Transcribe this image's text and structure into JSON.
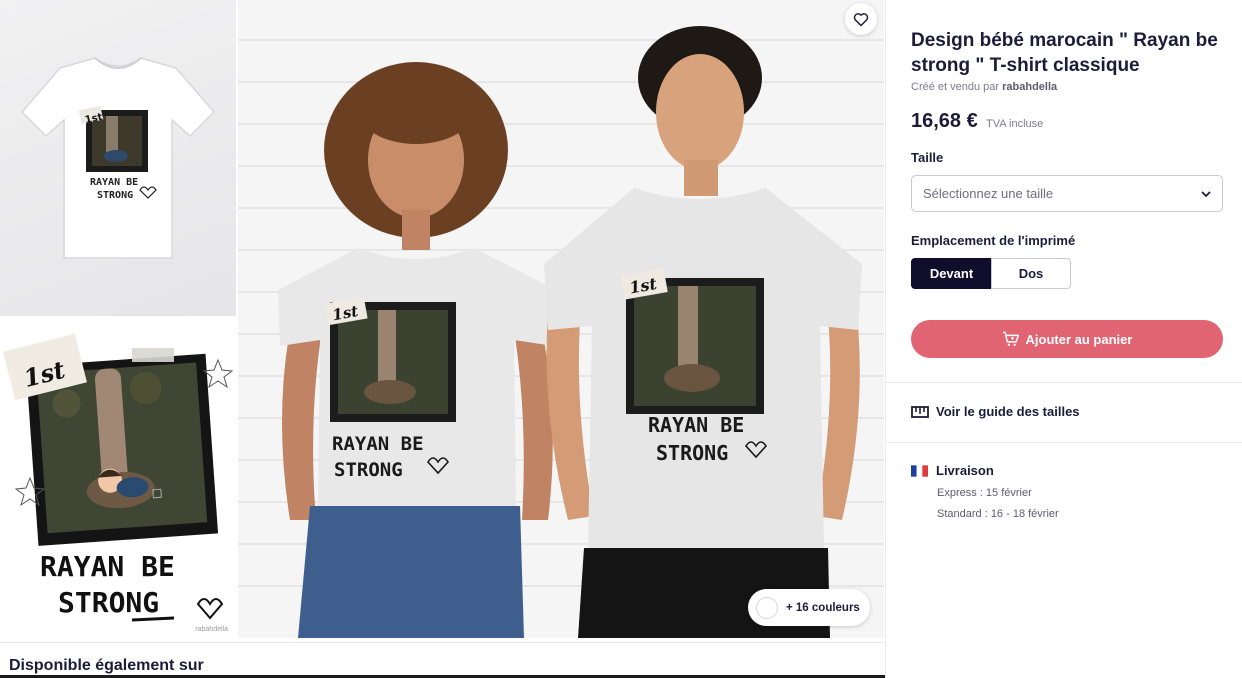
{
  "product": {
    "title": "Design bébé marocain \" Rayan be strong \" T-shirt classique",
    "creator_prefix": "Créé et vendu par",
    "creator_name": "rabahdella",
    "price": "16,68 €",
    "tax_note": "TVA incluse"
  },
  "size": {
    "label": "Taille",
    "placeholder": "Sélectionnez une taille"
  },
  "print_location": {
    "label": "Emplacement de l'imprimé",
    "options": [
      "Devant",
      "Dos"
    ],
    "selected": "Devant"
  },
  "cart": {
    "button_label": "Ajouter au panier",
    "icon": "cart-plus-icon"
  },
  "size_guide": {
    "label": "Voir le guide des tailles",
    "icon": "ruler-icon"
  },
  "delivery": {
    "label": "Livraison",
    "flag": "france-flag-icon",
    "express": "Express : 15 février",
    "standard": "Standard : 16 - 18 février"
  },
  "gallery": {
    "more_colors": "+ 16 couleurs",
    "favorite_icon": "heart-icon",
    "design_text_line1": "RAYAN BE",
    "design_text_line2": "STRONG",
    "design_badge": "1st",
    "thumb_credit": "rabahdella"
  },
  "bottom": {
    "section_title": "Disponible également sur"
  },
  "colors": {
    "accent": "#e06472",
    "selected_segment": "#0f0e2c",
    "title_text": "#1d1b3a"
  }
}
